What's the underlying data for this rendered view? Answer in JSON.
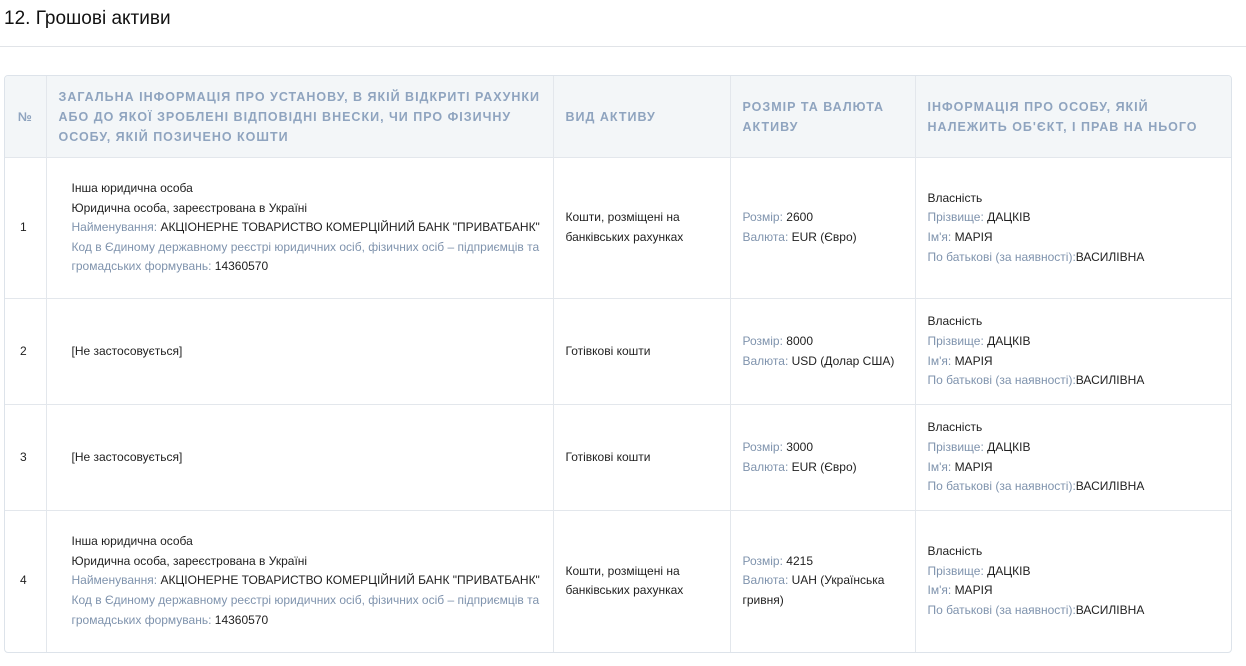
{
  "section": {
    "title": "12. Грошові активи"
  },
  "table": {
    "headers": {
      "num": "№",
      "institution": "Загальна інформація про установу, в якій відкриті рахунки або до якої зроблені відповідні внески, чи про фізичну особу, якій позичено кошти",
      "asset_type": "Вид активу",
      "amount": "Розмір та валюта активу",
      "owner": "Інформація про особу, якій належить об'єкт, і прав на нього"
    },
    "labels": {
      "name": "Найменування:",
      "edrpou": "Код в Єдиному державному реєстрі юридичних осіб, фізичних осіб – підприємців та громадських формувань:",
      "size": "Розмір:",
      "currency": "Валюта:",
      "surname": "Прізвище:",
      "first_name": "Ім'я:",
      "patronymic": "По батькові (за наявності):"
    },
    "rows": [
      {
        "num": "1",
        "inst_kind": "Інша юридична особа",
        "inst_sub": "Юридична особа, зареєстрована в Україні",
        "inst_name": "АКЦІОНЕРНЕ ТОВАРИСТВО КОМЕРЦІЙНИЙ БАНК \"ПРИВАТБАНК\"",
        "inst_code": "14360570",
        "asset_type": "Кошти, розміщені на банківських рахунках",
        "size": "2600",
        "currency": "EUR (Євро)",
        "ownership": "Власність",
        "surname": "ДАЦКІВ",
        "first_name": "МАРІЯ",
        "patronymic": "ВАСИЛІВНА"
      },
      {
        "num": "2",
        "inst_na": "[Не застосовується]",
        "asset_type": "Готівкові кошти",
        "size": "8000",
        "currency": "USD (Долар США)",
        "ownership": "Власність",
        "surname": "ДАЦКІВ",
        "first_name": "МАРІЯ",
        "patronymic": "ВАСИЛІВНА"
      },
      {
        "num": "3",
        "inst_na": "[Не застосовується]",
        "asset_type": "Готівкові кошти",
        "size": "3000",
        "currency": "EUR (Євро)",
        "ownership": "Власність",
        "surname": "ДАЦКІВ",
        "first_name": "МАРІЯ",
        "patronymic": "ВАСИЛІВНА"
      },
      {
        "num": "4",
        "inst_kind": "Інша юридична особа",
        "inst_sub": "Юридична особа, зареєстрована в Україні",
        "inst_name": "АКЦІОНЕРНЕ ТОВАРИСТВО КОМЕРЦІЙНИЙ БАНК \"ПРИВАТБАНК\"",
        "inst_code": "14360570",
        "asset_type": "Кошти, розміщені на банківських рахунках",
        "size": "4215",
        "currency": "UAH (Українська гривня)",
        "ownership": "Власність",
        "surname": "ДАЦКІВ",
        "first_name": "МАРІЯ",
        "patronymic": "ВАСИЛІВНА"
      }
    ]
  }
}
